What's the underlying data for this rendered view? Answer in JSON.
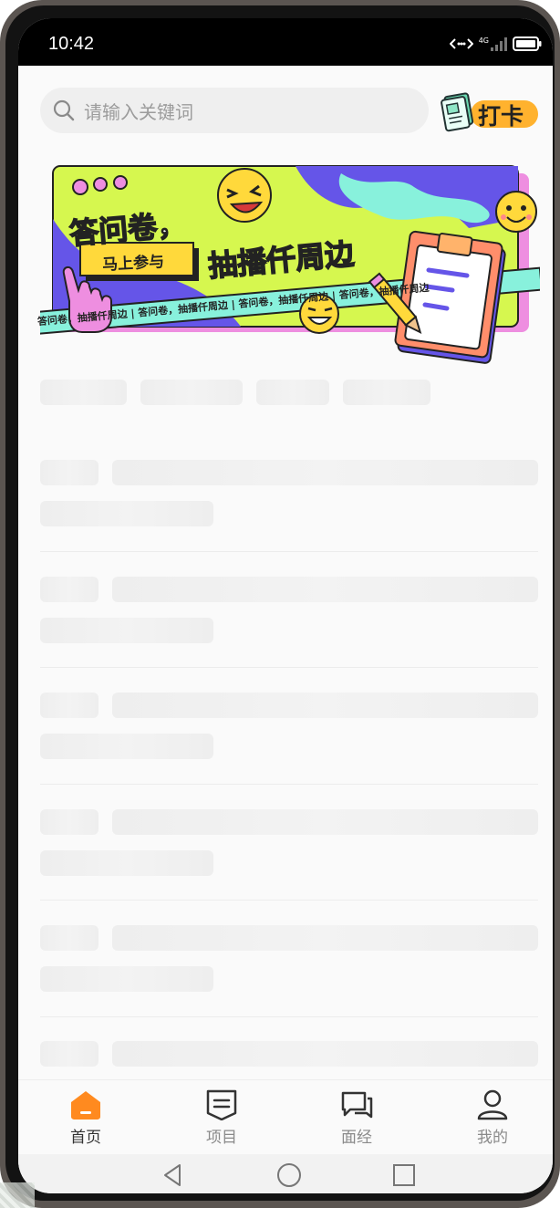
{
  "status_bar": {
    "time": "10:42",
    "network": "4G",
    "icons": [
      "hotspot-icon",
      "signal-icon",
      "battery-icon"
    ]
  },
  "search": {
    "placeholder": "请输入关键词",
    "icon": "search-icon"
  },
  "punch_in": {
    "label": "打卡",
    "icon": "notebook-icon",
    "accent": "#ffb22e"
  },
  "banner": {
    "title": "答问卷，",
    "subtitle": "抽播仟周边",
    "button_label": "马上参与",
    "ribbon_text": "答问卷，抽播仟周边 | 答问卷，抽播仟周边 | 答问卷，抽播仟周边 | 答问卷，抽播仟周边",
    "colors": {
      "lime": "#d6f74f",
      "purple": "#6555e8",
      "mint": "#88f1dc",
      "yellow": "#ffd93b",
      "pink": "#ee8ee0"
    }
  },
  "tab_bar": {
    "active_color": "#ff8a1f",
    "items": [
      {
        "label": "首页",
        "icon": "home-icon",
        "active": true
      },
      {
        "label": "项目",
        "icon": "project-icon",
        "active": false
      },
      {
        "label": "面经",
        "icon": "chat-icon",
        "active": false
      },
      {
        "label": "我的",
        "icon": "profile-icon",
        "active": false
      }
    ]
  },
  "nav_bar": {
    "buttons": [
      "back-triangle-icon",
      "home-circle-icon",
      "recent-square-icon"
    ]
  }
}
